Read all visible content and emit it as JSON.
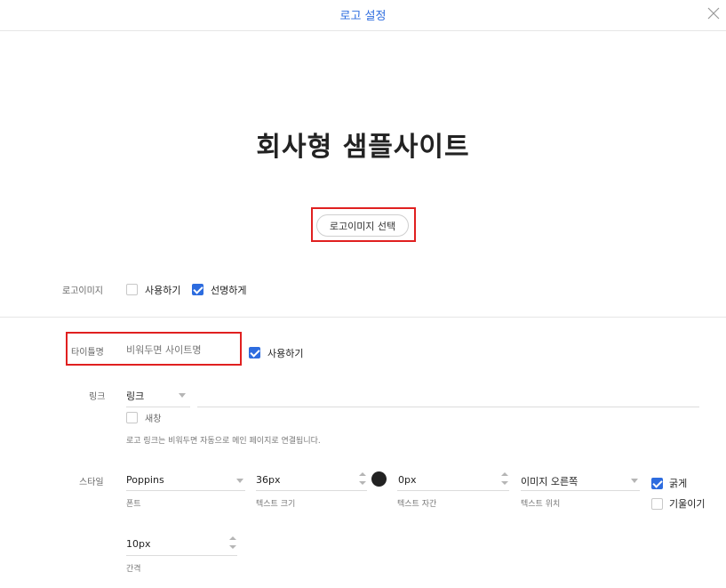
{
  "header": {
    "title": "로고 설정",
    "close_icon": "close-icon"
  },
  "preview": {
    "title": "회사형 샘플사이트",
    "logo_image_button": "로고이미지 선택"
  },
  "logo_image": {
    "label": "로고이미지",
    "use_label": "사용하기",
    "use_checked": false,
    "clear_label": "선명하게",
    "clear_checked": true
  },
  "title_name": {
    "label": "타이틀명",
    "placeholder": "비워두면 사이트명",
    "value": "",
    "use_label": "사용하기",
    "use_checked": true
  },
  "link": {
    "label": "링크",
    "select_value": "링크",
    "url_value": "",
    "new_window_label": "새창",
    "new_window_checked": false,
    "hint": "로고 링크는 비워두면 자동으로 메인 페이지로 연결됩니다."
  },
  "style": {
    "label": "스타일",
    "font": {
      "value": "Poppins",
      "helper": "폰트"
    },
    "text_size": {
      "value": "36px",
      "helper": "텍스트 크기"
    },
    "text_color": "#222222",
    "letter_spacing": {
      "value": "0px",
      "helper": "텍스트 자간"
    },
    "text_position": {
      "value": "이미지 오른쪽",
      "helper": "텍스트 위치"
    },
    "bold": {
      "label": "굵게",
      "checked": true
    },
    "italic": {
      "label": "기울이기",
      "checked": false
    },
    "gap": {
      "value": "10px",
      "helper": "간격"
    }
  },
  "colors": {
    "accent": "#2d6cdf",
    "highlight": "#e02020"
  }
}
